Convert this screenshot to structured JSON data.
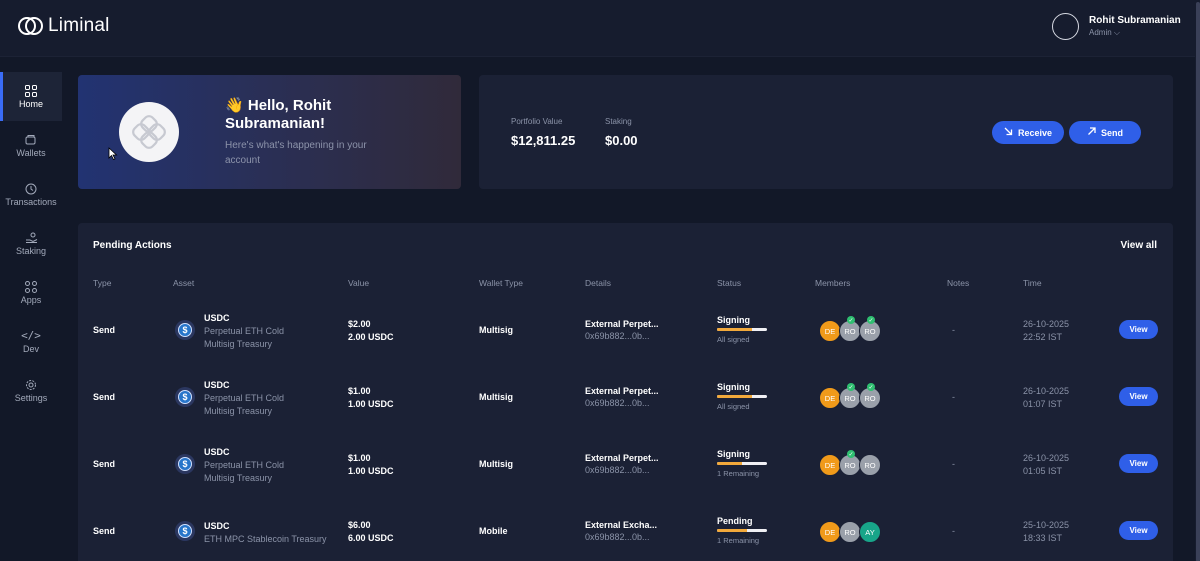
{
  "app": {
    "name": "Liminal"
  },
  "user": {
    "name": "Rohit Subramanian",
    "role": "Admin"
  },
  "sidebar": {
    "items": [
      {
        "label": "Home",
        "icon": "home-icon",
        "active": true
      },
      {
        "label": "Wallets",
        "icon": "wallet-icon",
        "active": false
      },
      {
        "label": "Transactions",
        "icon": "clock-icon",
        "active": false
      },
      {
        "label": "Staking",
        "icon": "staking-icon",
        "active": false
      },
      {
        "label": "Apps",
        "icon": "apps-icon",
        "active": false
      },
      {
        "label": "Dev",
        "icon": "code-icon",
        "active": false
      },
      {
        "label": "Settings",
        "icon": "gear-icon",
        "active": false
      }
    ]
  },
  "hero": {
    "emoji": "👋",
    "greeting": "Hello, Rohit Subramanian!",
    "subtitle": "Here's what's happening in your account"
  },
  "portfolio": {
    "value_label": "Portfolio Value",
    "value": "$12,811.25",
    "staking_label": "Staking",
    "staking": "$0.00",
    "receive_label": "Receive",
    "send_label": "Send"
  },
  "pending": {
    "title": "Pending Actions",
    "view_all": "View all",
    "columns": [
      "Type",
      "Asset",
      "Value",
      "Wallet Type",
      "Details",
      "Status",
      "Members",
      "Notes",
      "Time"
    ],
    "rows": [
      {
        "type": "Send",
        "asset": "USDC",
        "wallet_lines": [
          "Perpetual ETH Cold",
          "Multisig Treasury"
        ],
        "value_usd": "$2.00",
        "value_amt": "2.00 USDC",
        "wallet_type": "Multisig",
        "details_title": "External Perpet...",
        "details_addr": "0x69b882...0b...",
        "status": "Signing",
        "progress": 0.7,
        "status_note": "All signed",
        "members": [
          {
            "initials": "DE",
            "color": "#f09a1a",
            "signed": false
          },
          {
            "initials": "RO",
            "color": "#9aa0aa",
            "signed": true
          },
          {
            "initials": "RO",
            "color": "#9aa0aa",
            "signed": true
          }
        ],
        "notes": "-",
        "date": "26-10-2025",
        "time": "22:52 IST",
        "action": "View"
      },
      {
        "type": "Send",
        "asset": "USDC",
        "wallet_lines": [
          "Perpetual ETH Cold",
          "Multisig Treasury"
        ],
        "value_usd": "$1.00",
        "value_amt": "1.00 USDC",
        "wallet_type": "Multisig",
        "details_title": "External Perpet...",
        "details_addr": "0x69b882...0b...",
        "status": "Signing",
        "progress": 0.7,
        "status_note": "All signed",
        "members": [
          {
            "initials": "DE",
            "color": "#f09a1a",
            "signed": false
          },
          {
            "initials": "RO",
            "color": "#9aa0aa",
            "signed": true
          },
          {
            "initials": "RO",
            "color": "#9aa0aa",
            "signed": true
          }
        ],
        "notes": "-",
        "date": "26-10-2025",
        "time": "01:07 IST",
        "action": "View"
      },
      {
        "type": "Send",
        "asset": "USDC",
        "wallet_lines": [
          "Perpetual ETH Cold",
          "Multisig Treasury"
        ],
        "value_usd": "$1.00",
        "value_amt": "1.00 USDC",
        "wallet_type": "Multisig",
        "details_title": "External Perpet...",
        "details_addr": "0x69b882...0b...",
        "status": "Signing",
        "progress": 0.5,
        "status_note": "1 Remaining",
        "members": [
          {
            "initials": "DE",
            "color": "#f09a1a",
            "signed": false
          },
          {
            "initials": "RO",
            "color": "#9aa0aa",
            "signed": true
          },
          {
            "initials": "RO",
            "color": "#9aa0aa",
            "signed": false
          }
        ],
        "notes": "-",
        "date": "26-10-2025",
        "time": "01:05 IST",
        "action": "View"
      },
      {
        "type": "Send",
        "asset": "USDC",
        "wallet_lines": [
          "ETH MPC Stablecoin Treasury"
        ],
        "value_usd": "$6.00",
        "value_amt": "6.00 USDC",
        "wallet_type": "Mobile",
        "details_title": "External Excha...",
        "details_addr": "0x69b882...0b...",
        "status": "Pending",
        "progress": 0.6,
        "status_note": "1 Remaining",
        "members": [
          {
            "initials": "DE",
            "color": "#f09a1a",
            "signed": false
          },
          {
            "initials": "RO",
            "color": "#9aa0aa",
            "signed": false
          },
          {
            "initials": "AY",
            "color": "#18a589",
            "signed": false
          }
        ],
        "notes": "-",
        "date": "25-10-2025",
        "time": "18:33 IST",
        "action": "View"
      }
    ]
  }
}
